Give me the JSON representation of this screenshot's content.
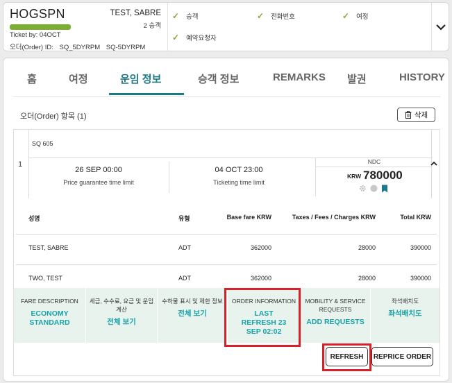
{
  "header": {
    "pnr": "HOGSPN",
    "ticket_by": "Ticket by: 04OCT",
    "order_id_label": "오더(Order) ID:",
    "order_ids": [
      "SQ_5DYRPM",
      "SQ-5DYRPM"
    ],
    "passenger_name": "TEST, SABRE",
    "passenger_count": "2 승객",
    "checks": [
      "승객",
      "전화번호",
      "여정",
      "예약요청자"
    ],
    "progress_color": "#7cae32"
  },
  "tabs": [
    {
      "label": "홈"
    },
    {
      "label": "여정"
    },
    {
      "label": "운임 정보",
      "active": true
    },
    {
      "label": "승객 정보"
    },
    {
      "label": "REMARKS"
    },
    {
      "label": "발권"
    },
    {
      "label": "HISTORY"
    }
  ],
  "order_section": {
    "title": "오더(Order) 항목 (1)",
    "delete_label": "삭제"
  },
  "item": {
    "index": "1",
    "flight": "SQ 605",
    "price_guarantee": {
      "time": "26 SEP 00:00",
      "label": "Price guarantee time limit"
    },
    "ticketing": {
      "time": "04 OCT 23:00",
      "label": "Ticketing time limit"
    },
    "ndc_label": "NDC",
    "currency": "KRW",
    "amount": "780000"
  },
  "passengers_table": {
    "headers": [
      "성명",
      "유형",
      "Base fare KRW",
      "Taxes / Fees / Charges KRW",
      "Total KRW"
    ],
    "rows": [
      [
        "TEST, SABRE",
        "ADT",
        "362000",
        "28000",
        "390000"
      ],
      [
        "TWO, TEST",
        "ADT",
        "362000",
        "28000",
        "390000"
      ]
    ]
  },
  "fare_cards": [
    {
      "title": "FARE DESCRIPTION",
      "value": "ECONOMY STANDARD"
    },
    {
      "title": "세금, 수수료, 요금 및 운임 계산",
      "value": "전체 보기"
    },
    {
      "title": "수하물 표시 및 제한 정보",
      "value": "전체 보기"
    },
    {
      "title": "ORDER INFORMATION",
      "value": "LAST REFRESH 23 SEP 02:02"
    },
    {
      "title": "MOBILITY & SERVICE REQUESTS",
      "value": "ADD REQUESTS"
    },
    {
      "title": "좌석배치도",
      "value": "좌석배치도"
    }
  ],
  "actions": {
    "refresh_label": "REFRESH",
    "reprice_label": "REPRICE ORDER"
  },
  "colors": {
    "accent": "#1d7a88",
    "link": "#17a2a8",
    "highlight": "#d6202a",
    "fare_bg": "#e8f3ee"
  }
}
